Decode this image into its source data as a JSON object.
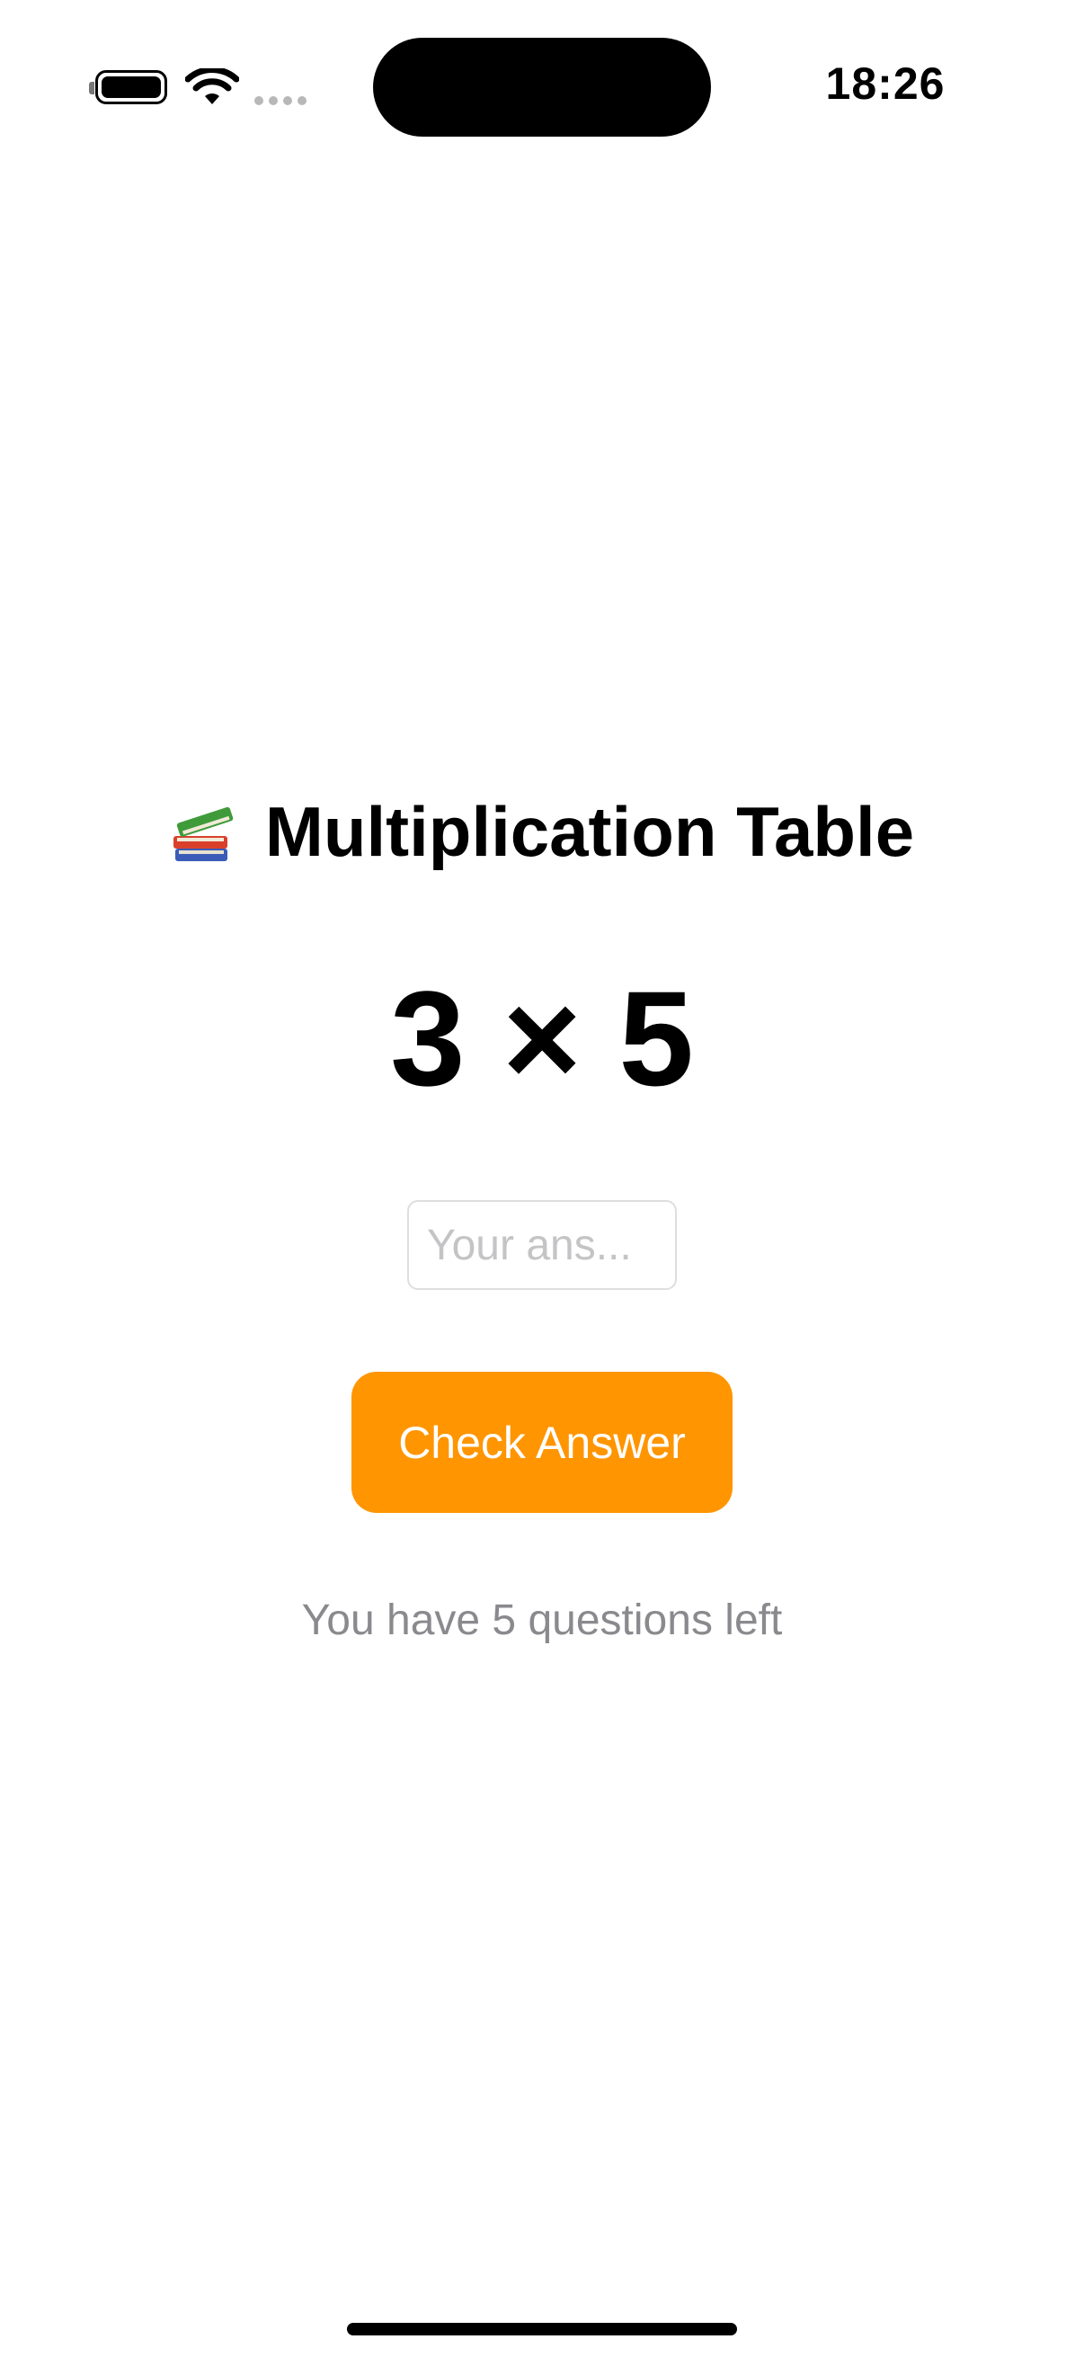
{
  "status_bar": {
    "time": "18:26",
    "icons": [
      "battery-icon",
      "wifi-icon",
      "cellular-signal-icon"
    ]
  },
  "app": {
    "title_icon": "books-icon",
    "title": "Multiplication Table",
    "question": "3 × 5",
    "answer_input": {
      "placeholder": "Your ans...",
      "value": ""
    },
    "check_button_label": "Check Answer",
    "remaining_text": "You have 5 questions left"
  },
  "colors": {
    "accent": "#ff9500",
    "secondary_text": "#8a8a8e",
    "placeholder": "#c4c4c6"
  }
}
